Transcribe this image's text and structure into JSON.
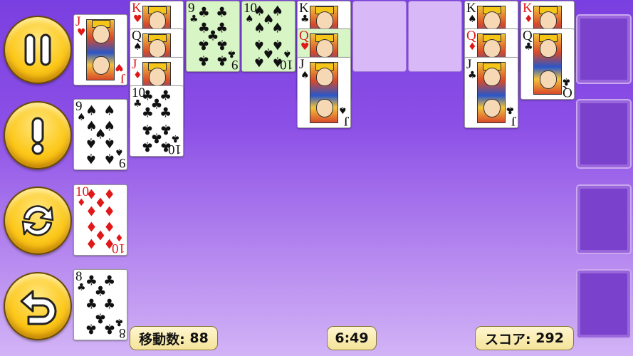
{
  "controls": {
    "pause_icon": "pause-icon",
    "hint_icon": "exclamation-icon",
    "redeal_icon": "refresh-icon",
    "undo_icon": "undo-icon",
    "button_color": "#fcc81a"
  },
  "status": {
    "moves_label": "移動数:",
    "moves_value": "88",
    "timer": "6:49",
    "score_label": "スコア:",
    "score_value": "292"
  },
  "cards": {
    "col0_jh": {
      "rank": "J",
      "suit": "♥"
    },
    "col0_9s": {
      "rank": "9",
      "suit": "♠"
    },
    "col0_10d": {
      "rank": "10",
      "suit": "♦"
    },
    "col0_8c": {
      "rank": "8",
      "suit": "♣"
    },
    "col1_kh": {
      "rank": "K",
      "suit": "♥"
    },
    "col1_qs": {
      "rank": "Q",
      "suit": "♠"
    },
    "col1_jd": {
      "rank": "J",
      "suit": "♦"
    },
    "col1_10c": {
      "rank": "10",
      "suit": "♣"
    },
    "col2_9c": {
      "rank": "9",
      "suit": "♣"
    },
    "col3_10s": {
      "rank": "10",
      "suit": "♠"
    },
    "col4_kc": {
      "rank": "K",
      "suit": "♣"
    },
    "col4_qh": {
      "rank": "Q",
      "suit": "♥"
    },
    "col4_js": {
      "rank": "J",
      "suit": "♠"
    },
    "col7_ks": {
      "rank": "K",
      "suit": "♠"
    },
    "col7_qd": {
      "rank": "Q",
      "suit": "♦"
    },
    "col7_jc": {
      "rank": "J",
      "suit": "♣"
    },
    "col8_kd": {
      "rank": "K",
      "suit": "♦"
    },
    "col8_qc": {
      "rank": "Q",
      "suit": "♣"
    }
  },
  "colors": {
    "background_top": "#7a3fe0",
    "background_bottom": "#d2b3f6",
    "highlight_card": "#d8f5c6",
    "red_suit": "#e01818"
  }
}
